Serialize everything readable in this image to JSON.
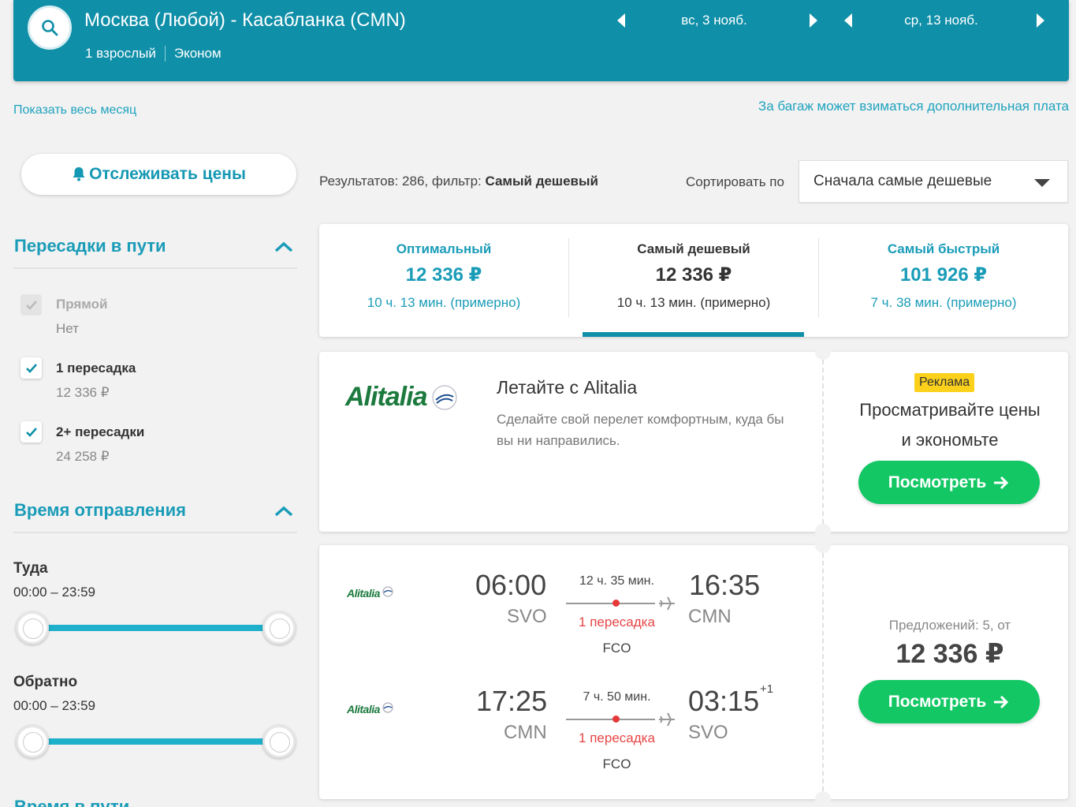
{
  "header": {
    "route": "Москва (Любой) - Касабланка (CMN)",
    "passengers": "1 взрослый",
    "cabin": "Эконом",
    "depart_date": "вс, 3 нояб.",
    "return_date": "ср, 13 нояб."
  },
  "links": {
    "show_month": "Показать весь месяц",
    "baggage_note": "За багаж может взиматься дополнительная плата"
  },
  "sidebar": {
    "track_prices": "Отслеживать цены",
    "stops_title": "Пересадки в пути",
    "stops": [
      {
        "label": "Прямой",
        "price": "Нет",
        "checked": true,
        "disabled": true
      },
      {
        "label": "1 пересадка",
        "price": "12 336 ₽",
        "checked": true,
        "disabled": false
      },
      {
        "label": "2+ пересадки",
        "price": "24 258 ₽",
        "checked": true,
        "disabled": false
      }
    ],
    "departure_title": "Время отправления",
    "outbound_label": "Туда",
    "outbound_range": "00:00 – 23:59",
    "return_label": "Обратно",
    "return_range": "00:00 – 23:59",
    "duration_title": "Время в пути"
  },
  "results": {
    "count_text": "Результатов: 286, фильтр: ",
    "filter_name": "Самый дешевый",
    "sort_label": "Сортировать по",
    "sort_value": "Сначала самые дешевые"
  },
  "tabs": [
    {
      "title": "Оптимальный",
      "price": "12 336 ₽",
      "duration": "10 ч. 13 мин. (примерно)"
    },
    {
      "title": "Самый дешевый",
      "price": "12 336 ₽",
      "duration": "10 ч. 13 мин. (примерно)"
    },
    {
      "title": "Самый быстрый",
      "price": "101 926 ₽",
      "duration": "7 ч. 38 мин. (примерно)"
    }
  ],
  "ad": {
    "logo_text": "Alitalia",
    "title": "Летайте с Alitalia",
    "text": "Сделайте свой перелет комфортным, куда бы вы ни направились.",
    "badge": "Реклама",
    "promo": "Просматривайте цены и экономьте",
    "button": "Посмотреть"
  },
  "flight": {
    "airline_logo": "Alitalia",
    "outbound": {
      "dep_time": "06:00",
      "dep_code": "SVO",
      "duration": "12 ч. 35 мин.",
      "stops": "1 пересадка",
      "via": "FCO",
      "arr_time": "16:35",
      "arr_code": "CMN"
    },
    "inbound": {
      "dep_time": "17:25",
      "dep_code": "CMN",
      "duration": "7 ч. 50 мин.",
      "stops": "1 пересадка",
      "via": "FCO",
      "arr_time": "03:15",
      "arr_day": "+1",
      "arr_code": "SVO"
    },
    "offers": "Предложений: 5, от",
    "price": "12 336 ₽",
    "button": "Посмотреть"
  },
  "colors": {
    "header": "#0f8fa8",
    "accent": "#1a9cb8",
    "cta": "#13c764",
    "stop": "#e64646",
    "badge": "#fbd11b"
  }
}
